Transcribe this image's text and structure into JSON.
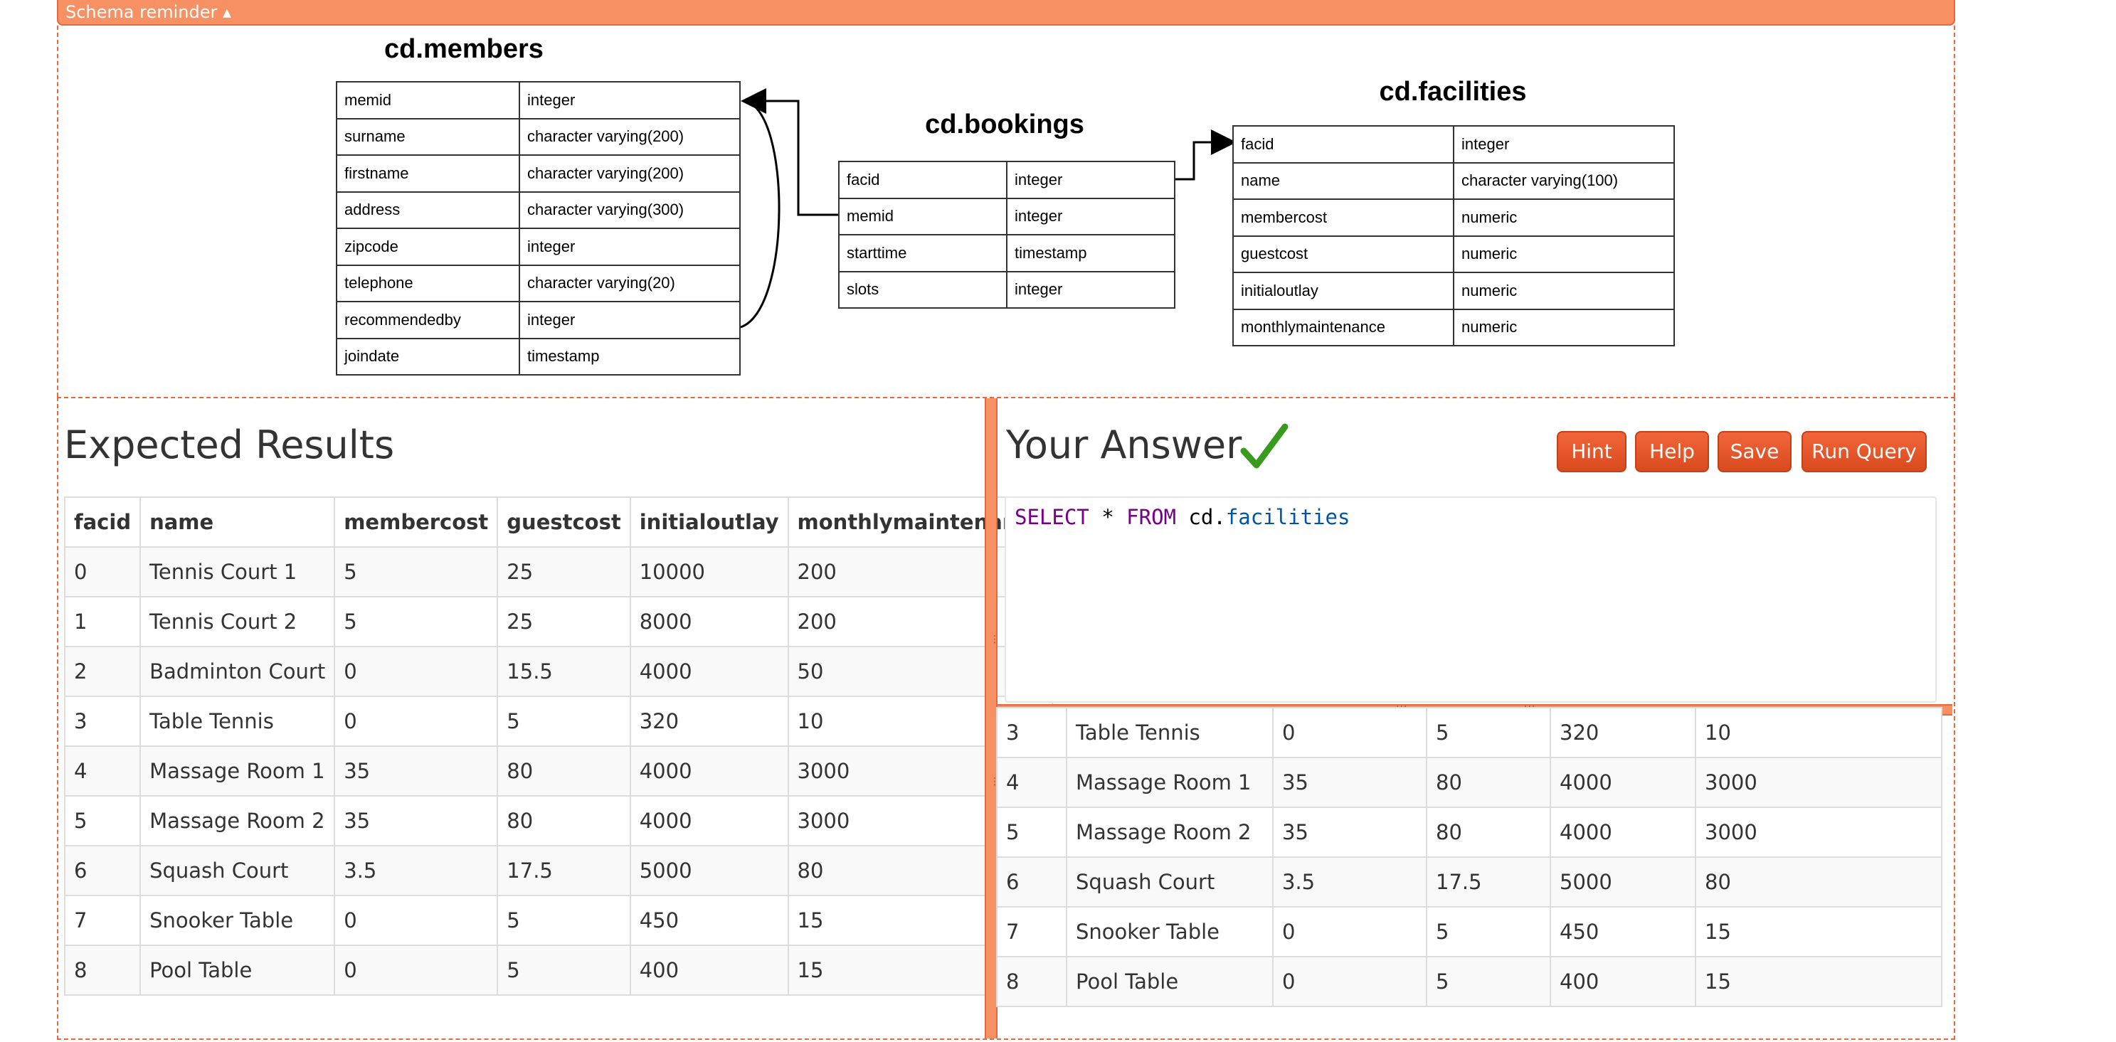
{
  "schema_bar": {
    "label": "Schema reminder ▴"
  },
  "schema": {
    "members": {
      "title": "cd.members",
      "rows": [
        [
          "memid",
          "integer"
        ],
        [
          "surname",
          "character varying(200)"
        ],
        [
          "firstname",
          "character varying(200)"
        ],
        [
          "address",
          "character varying(300)"
        ],
        [
          "zipcode",
          "integer"
        ],
        [
          "telephone",
          "character varying(20)"
        ],
        [
          "recommendedby",
          "integer"
        ],
        [
          "joindate",
          "timestamp"
        ]
      ]
    },
    "bookings": {
      "title": "cd.bookings",
      "rows": [
        [
          "facid",
          "integer"
        ],
        [
          "memid",
          "integer"
        ],
        [
          "starttime",
          "timestamp"
        ],
        [
          "slots",
          "integer"
        ]
      ]
    },
    "facilities": {
      "title": "cd.facilities",
      "rows": [
        [
          "facid",
          "integer"
        ],
        [
          "name",
          "character varying(100)"
        ],
        [
          "membercost",
          "numeric"
        ],
        [
          "guestcost",
          "numeric"
        ],
        [
          "initialoutlay",
          "numeric"
        ],
        [
          "monthlymaintenance",
          "numeric"
        ]
      ]
    }
  },
  "expected": {
    "heading": "Expected Results",
    "columns": [
      "facid",
      "name",
      "membercost",
      "guestcost",
      "initialoutlay",
      "monthlymaintenance"
    ],
    "rows": [
      [
        "0",
        "Tennis Court 1",
        "5",
        "25",
        "10000",
        "200"
      ],
      [
        "1",
        "Tennis Court 2",
        "5",
        "25",
        "8000",
        "200"
      ],
      [
        "2",
        "Badminton Court",
        "0",
        "15.5",
        "4000",
        "50"
      ],
      [
        "3",
        "Table Tennis",
        "0",
        "5",
        "320",
        "10"
      ],
      [
        "4",
        "Massage Room 1",
        "35",
        "80",
        "4000",
        "3000"
      ],
      [
        "5",
        "Massage Room 2",
        "35",
        "80",
        "4000",
        "3000"
      ],
      [
        "6",
        "Squash Court",
        "3.5",
        "17.5",
        "5000",
        "80"
      ],
      [
        "7",
        "Snooker Table",
        "0",
        "5",
        "450",
        "15"
      ],
      [
        "8",
        "Pool Table",
        "0",
        "5",
        "400",
        "15"
      ]
    ]
  },
  "answer": {
    "heading": "Your Answer",
    "status_icon": "checkmark-icon",
    "status_color": "#3a9a1e",
    "buttons": {
      "hint": "Hint",
      "help": "Help",
      "save": "Save",
      "run": "Run Query"
    },
    "query": {
      "kw1": "SELECT",
      "star": " * ",
      "kw2": "FROM",
      "schema": " cd.",
      "table": "facilities"
    },
    "results": {
      "rows": [
        [
          "3",
          "Table Tennis",
          "0",
          "5",
          "320",
          "10"
        ],
        [
          "4",
          "Massage Room 1",
          "35",
          "80",
          "4000",
          "3000"
        ],
        [
          "5",
          "Massage Room 2",
          "35",
          "80",
          "4000",
          "3000"
        ],
        [
          "6",
          "Squash Court",
          "3.5",
          "17.5",
          "5000",
          "80"
        ],
        [
          "7",
          "Snooker Table",
          "0",
          "5",
          "450",
          "15"
        ],
        [
          "8",
          "Pool Table",
          "0",
          "5",
          "400",
          "15"
        ]
      ]
    }
  },
  "colors": {
    "accent": "#f79062",
    "accent_border": "#e8693d",
    "button": "#e05a2b"
  }
}
